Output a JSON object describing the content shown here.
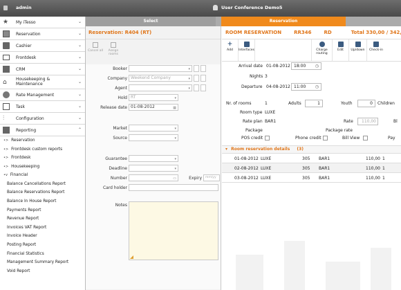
{
  "topbar": {
    "user": "admin",
    "conference": "User Conference Demo5"
  },
  "sidebar": {
    "menu": [
      {
        "label": "My iTesso",
        "icon": "star-icon"
      },
      {
        "label": "Reservation",
        "icon": "calendar-icon"
      },
      {
        "label": "Cashier",
        "icon": "cashier-icon"
      },
      {
        "label": "Frontdesk",
        "icon": "monitor-icon"
      },
      {
        "label": "CRM",
        "icon": "crm-icon"
      },
      {
        "label": "Housekeeping & Maintenance",
        "icon": "house-icon"
      },
      {
        "label": "Rate Management",
        "icon": "rate-icon"
      },
      {
        "label": "Task",
        "icon": "task-icon"
      },
      {
        "label": "Configuration",
        "icon": "config-icon"
      },
      {
        "label": "Reporting",
        "icon": "report-icon"
      }
    ],
    "sub_items": [
      "Reservation",
      "Frontdesk custom reports",
      "Frontdesk",
      "Housekeeping",
      "Financial"
    ],
    "reports": [
      "Balance Cancellations Report",
      "Balance Reservations Report",
      "Balance In House Report",
      "Payments Report",
      "Revenue Report",
      "Invoices VAT Report",
      "Invoice Header",
      "Posting Report",
      "Financial Statistics",
      "Management Summary Report",
      "Void Report"
    ]
  },
  "tabs": {
    "select": "Select",
    "reservation": "Reservation"
  },
  "left": {
    "title": "Reservation: R404 (RT)",
    "toolbar": {
      "cancel_all": "Cancel all",
      "assign_rooms": "Assign rooms"
    },
    "fields": {
      "booker_label": "Booker",
      "company_label": "Company",
      "company_placeholder": "Weekend Company",
      "agent_label": "Agent",
      "hold_label": "Hold",
      "hold_value": "RT",
      "release_label": "Release date",
      "release_value": "01-08-2012",
      "market_label": "Market",
      "source_label": "Source",
      "guarantee_label": "Guarantee",
      "deadline_label": "Deadline",
      "number_label": "Number",
      "expiry_label": "Expiry",
      "expiry_placeholder": "mm/yy",
      "cardholder_label": "Card holder",
      "notes_label": "Notes"
    }
  },
  "right": {
    "header": {
      "title": "ROOM RESERVATION",
      "code": "RR346",
      "status": "RD",
      "total": "Total 330,00  /  342,00"
    },
    "toolbar": {
      "add": "Add",
      "interfaces": "Interfaces",
      "charge_routing": "Charge routing",
      "edit": "Edit",
      "updown": "Up/down",
      "checkin": "Check-in"
    },
    "arrival_label": "Arrival date",
    "arrival_date": "01-08-2012",
    "arrival_time": "18:00",
    "nights_label": "Nights",
    "nights": "3",
    "departure_label": "Departure",
    "departure_date": "04-08-2012",
    "departure_time": "11:00",
    "rooms_label": "Nr. of rooms",
    "rooms": "1",
    "adults_label": "Adults",
    "adults": "1",
    "youth_label": "Youth",
    "youth": "0",
    "children_label": "Children",
    "roomtype_label": "Room type",
    "roomtype": "LUXE",
    "rateplan_label": "Rate plan",
    "rateplan": "BAR1",
    "rate_label": "Rate",
    "rate": "110,00",
    "bl_label": "Bl",
    "package_label": "Package",
    "packagerate_label": "Package rate",
    "pos_label": "POS credit",
    "phone_label": "Phone credit",
    "billview_label": "Bill View",
    "pay_label": "Pay",
    "details_title": "Room reservation details",
    "details_count": "(3)",
    "details": [
      {
        "date": "01-08-2012",
        "type": "LUXE",
        "room": "305",
        "plan": "BAR1",
        "amount": "110,00",
        "qty": "1"
      },
      {
        "date": "02-08-2012",
        "type": "LUXE",
        "room": "305",
        "plan": "BAR1",
        "amount": "110,00",
        "qty": "1"
      },
      {
        "date": "03-08-2012",
        "type": "LUXE",
        "room": "305",
        "plan": "BAR1",
        "amount": "110,00",
        "qty": "1"
      }
    ]
  }
}
